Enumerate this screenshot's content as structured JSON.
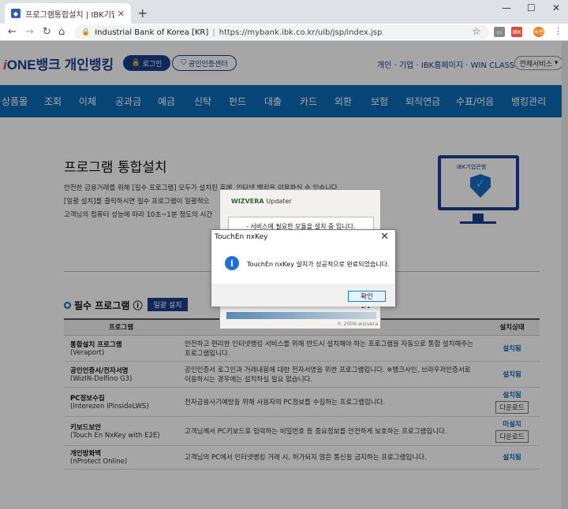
{
  "browser": {
    "tab_title": "프로그램통합설치 | IBK기업은행",
    "new_tab": "+",
    "url_site": "Industrial Bank of Korea [KR]",
    "url_sep": "|",
    "url": "https://mybank.ibk.co.kr/uib/jsp/index.jsp",
    "ext1": "IBK",
    "ext2": "숙련"
  },
  "header": {
    "logo_i": "i",
    "logo_one": "ONE",
    "logo_text": "뱅크 개인뱅킹",
    "login": "로그인",
    "cert_center": "공인인증센터",
    "top_links": "개인 · 기업 · IBK홈페이지 · WIN CLASS",
    "all_services": "전체서비스"
  },
  "nav": [
    "상품몰",
    "조회",
    "이체",
    "공과금",
    "예금",
    "신탁",
    "펀드",
    "대출",
    "카드",
    "외환",
    "보험",
    "퇴직연금",
    "수표/어음",
    "뱅킹관리"
  ],
  "main": {
    "title": "프로그램 통합설치",
    "bullets": [
      "안전한 금융거래를 위해 [필수 프로그램] 모두가 설치된 후에, 인터넷 뱅킹을 이용하실 수 있습니다.",
      "[일괄 설치]를 클릭하시면 필수 프로그램이 일괄적으",
      "고객님의 컴퓨터 성능에 따라 10초~1분 정도의 시간"
    ],
    "monitor_brand": "IBK기업은행",
    "required_title": "필수 프로그램",
    "install_all": "일괄 설치"
  },
  "table": {
    "headers": [
      "프로그램",
      "",
      "설치상태"
    ],
    "rows": [
      {
        "name": "통합설치 프로그램",
        "sub": "(Veraport)",
        "desc": "안전하고 편리한 인터넷뱅킹 서비스를 위해 반드시 설치해야 하는 프로그램을 자동으로 통합 설치해주는 프로그램입니다.",
        "status": "설치됨",
        "download": ""
      },
      {
        "name": "공인인증서/전자서명",
        "sub": "(WizIN-Delfino G3)",
        "desc": "공인인증서 로그인과 거래내용에 대한 전자서명을 위한 프로그램입니다. ※뱅크사인, 브라우저인증서로 이용하시는 경우에는 설치하실 필요 없습니다.",
        "status": "설치됨",
        "download": ""
      },
      {
        "name": "PC정보수집",
        "sub": "(Interezen IPinsideLWS)",
        "desc": "전자금융사기예방을 위해 사용자의 PC정보를 수집하는 프로그램입니다.",
        "status": "설치됨",
        "download": "다운로드"
      },
      {
        "name": "키보드보안",
        "sub": "(Touch En NxKey with E2E)",
        "desc": "고객님께서 PC키보드로 입력하는 비밀번호 등 중요정보를 안전하게 보호하는 프로그램입니다.",
        "status": "미설치",
        "download": "다운로드"
      },
      {
        "name": "개인방화벽",
        "sub": "(nProtect Online)",
        "desc": "고객님의 PC에서 인터넷뱅킹 거래 시, 허가되지 않은 통신을 금지하는 프로그램입니다.",
        "status": "설치됨",
        "download": ""
      }
    ]
  },
  "wizvera": {
    "brand": "WIZVERA",
    "app": "Updater",
    "message": "- 서비스에 필요한 모듈을 설치 중 입니다.",
    "count": "1/1",
    "progress": 1.0,
    "copyright": "© 2006 wizvera"
  },
  "dialog": {
    "title": "TouchEn nxKey",
    "close": "✕",
    "icon": "i",
    "message": "TouchEn nxKey 설치가 성공적으로 완료되었습니다.",
    "ok": "확인"
  }
}
